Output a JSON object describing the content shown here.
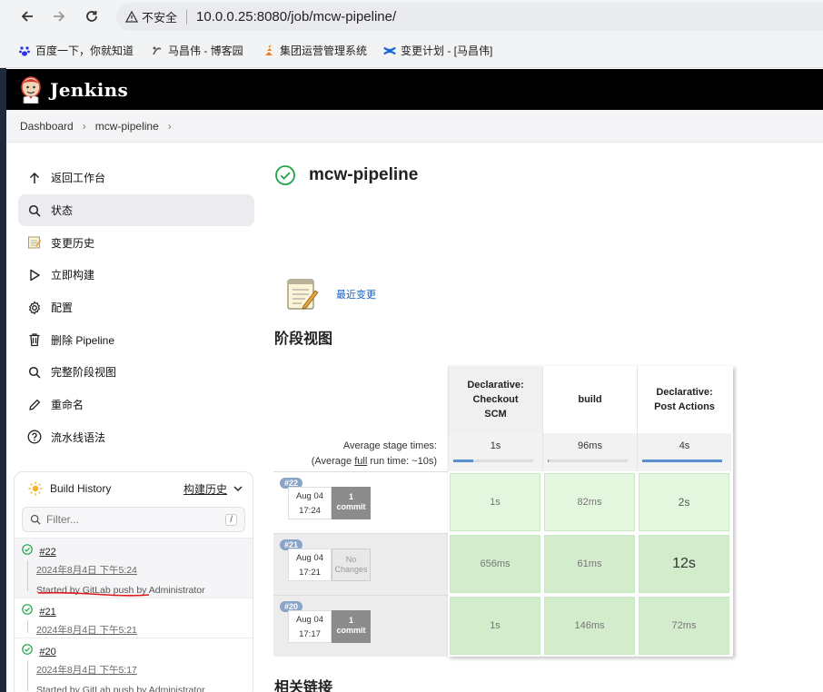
{
  "browser": {
    "insecure_label": "不安全",
    "url": "10.0.0.25:8080/job/mcw-pipeline/",
    "bookmarks": [
      {
        "label": "百度一下，你就知道",
        "icon": "baidu-paw-icon"
      },
      {
        "label": "马昌伟 - 博客园",
        "icon": "cnblogs-icon"
      },
      {
        "label": "集团运营管理系统",
        "icon": "fire-icon"
      },
      {
        "label": "变更计划 - [马昌伟]",
        "icon": "confluence-icon"
      }
    ]
  },
  "header": {
    "title": "Jenkins"
  },
  "breadcrumb": {
    "items": [
      "Dashboard",
      "mcw-pipeline"
    ]
  },
  "sidebar": {
    "items": [
      {
        "label": "返回工作台",
        "icon": "arrow-up-icon"
      },
      {
        "label": "状态",
        "icon": "search-icon"
      },
      {
        "label": "变更历史",
        "icon": "notepad-icon"
      },
      {
        "label": "立即构建",
        "icon": "play-icon"
      },
      {
        "label": "配置",
        "icon": "gear-icon"
      },
      {
        "label": "删除 Pipeline",
        "icon": "trash-icon"
      },
      {
        "label": "完整阶段视图",
        "icon": "search-icon"
      },
      {
        "label": "重命名",
        "icon": "pencil-icon"
      },
      {
        "label": "流水线语法",
        "icon": "question-icon"
      }
    ]
  },
  "build_history": {
    "title": "Build History",
    "link": "构建历史",
    "filter_placeholder": "Filter...",
    "shortcut": "/",
    "builds": [
      {
        "number": "#22",
        "date": "2024年8月4日 下午5:24",
        "cause": "Started by GitLab push by Administrator"
      },
      {
        "number": "#21",
        "date": "2024年8月4日 下午5:21",
        "cause": ""
      },
      {
        "number": "#20",
        "date": "2024年8月4日 下午5:17",
        "cause": "Started by GitLab push by Administrator"
      }
    ]
  },
  "main": {
    "title": "mcw-pipeline",
    "recent_changes": "最近变更",
    "stage_view_heading": "阶段视图",
    "related_links_heading": "相关链接"
  },
  "stage_view": {
    "stages": [
      "Declarative: Checkout SCM",
      "build",
      "Declarative: Post Actions"
    ],
    "avg_label": "Average stage times:",
    "avg_full_prefix": "(Average ",
    "avg_full_word": "full",
    "avg_full_suffix": " run time: ~10s)",
    "avg_times": [
      "1s",
      "96ms",
      "4s"
    ],
    "avg_fill": [
      0.25,
      0.01,
      1.0
    ],
    "runs": [
      {
        "badge": "#22",
        "date": "Aug 04",
        "time": "17:24",
        "commit_top": "1",
        "commit_bottom": "commit",
        "has_commit": true,
        "durations": [
          "1s",
          "82ms",
          "2s"
        ]
      },
      {
        "badge": "#21",
        "date": "Aug 04",
        "time": "17:21",
        "commit_top": "No",
        "commit_bottom": "Changes",
        "has_commit": false,
        "durations": [
          "656ms",
          "61ms",
          "12s"
        ]
      },
      {
        "badge": "#20",
        "date": "Aug 04",
        "time": "17:17",
        "commit_top": "1",
        "commit_bottom": "commit",
        "has_commit": true,
        "durations": [
          "1s",
          "146ms",
          "72ms"
        ]
      }
    ]
  },
  "colors": {
    "success": "#1ea446",
    "stage_cell": "#e2f7dd",
    "annotation": "#e0191e",
    "link": "#1a5fbf"
  }
}
